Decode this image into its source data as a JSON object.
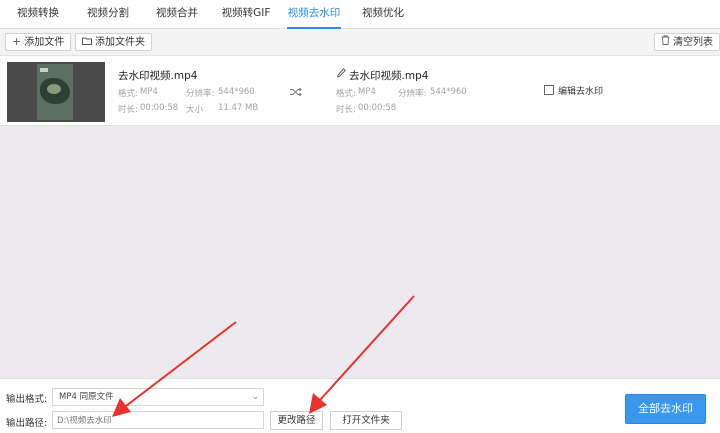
{
  "tabs": [
    {
      "label": "视频转换"
    },
    {
      "label": "视频分割"
    },
    {
      "label": "视频合并"
    },
    {
      "label": "视频转GIF"
    },
    {
      "label": "视频去水印",
      "active": true
    },
    {
      "label": "视频优化"
    }
  ],
  "toolbar": {
    "add_file": "添加文件",
    "add_folder": "添加文件夹",
    "clear_list": "清空列表"
  },
  "file": {
    "source": {
      "name": "去水印视频.mp4",
      "format_label": "格式:",
      "format": "MP4",
      "resolution_label": "分辨率:",
      "resolution": "544*960",
      "duration_label": "时长:",
      "duration": "00:00:58",
      "size_label": "大小",
      "size": "11.47 MB"
    },
    "output": {
      "name": "去水印视频.mp4",
      "format_label": "格式:",
      "format": "MP4",
      "resolution_label": "分辨率:",
      "resolution": "544*960",
      "duration_label": "时长:",
      "duration": "00:00:58"
    },
    "edit_label": "编辑去水印"
  },
  "bottom": {
    "format_label": "输出格式:",
    "format_value": "MP4  同原文件",
    "path_label": "输出路径:",
    "path_value": "D:\\视频去水印",
    "change_path": "更改路径",
    "open_folder": "打开文件夹",
    "process_all": "全部去水印"
  },
  "colors": {
    "accent": "#2b8ae6",
    "primary_button": "#3a97f0",
    "list_background": "#eceaee",
    "annotation_arrow": "#e8322a"
  },
  "icons": [
    "plus-icon",
    "folder-icon",
    "trash-icon",
    "shuffle-icon",
    "pencil-icon",
    "edit-icon",
    "chevron-down-icon"
  ]
}
